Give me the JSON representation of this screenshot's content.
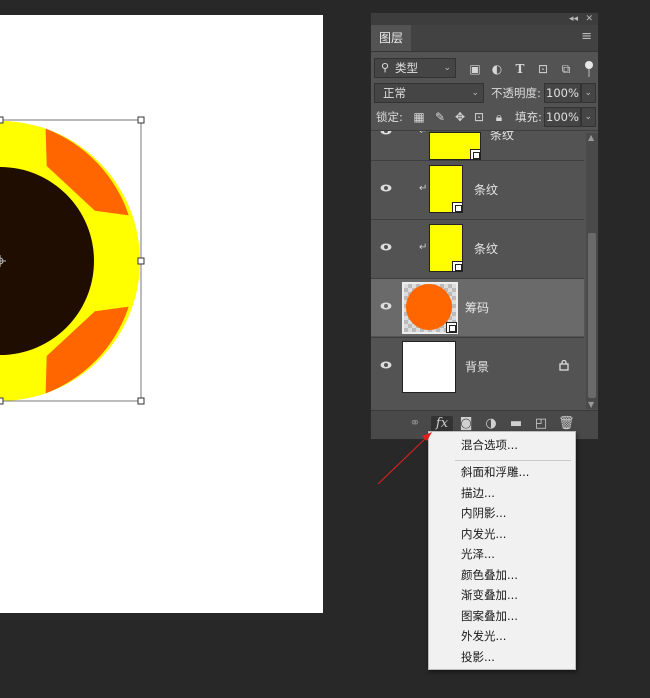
{
  "panel": {
    "tab_label": "图层",
    "menu_icon": "hamburger-icon",
    "collapse_icon": "double-chevron-icon",
    "close_icon": "close-icon"
  },
  "filter": {
    "kind_label": "类型",
    "icons": [
      "image-filter-icon",
      "adjustment-filter-icon",
      "type-filter-icon",
      "shape-filter-icon",
      "smart-object-filter-icon",
      "filter-toggle-icon"
    ]
  },
  "blend": {
    "mode": "正常",
    "opacity_label": "不透明度:",
    "opacity_value": "100%"
  },
  "lock": {
    "label": "锁定:",
    "fill_label": "填充:",
    "fill_value": "100%"
  },
  "layers": [
    {
      "name": "条纹",
      "clipped": true,
      "type": "stripe"
    },
    {
      "name": "条纹",
      "clipped": true,
      "type": "stripe"
    },
    {
      "name": "条纹",
      "clipped": true,
      "type": "stripe"
    },
    {
      "name": "筹码",
      "clipped": false,
      "type": "circle",
      "selected": true
    },
    {
      "name": "背景",
      "clipped": false,
      "type": "background",
      "locked": true
    }
  ],
  "bottom_icons": [
    "link-icon",
    "fx-icon",
    "mask-icon",
    "adjustment-icon",
    "folder-icon",
    "new-layer-icon",
    "trash-icon"
  ],
  "fx_label": "fx",
  "fx_menu": {
    "items": [
      "混合选项...",
      "斜面和浮雕...",
      "描边...",
      "内阴影...",
      "内发光...",
      "光泽...",
      "颜色叠加...",
      "渐变叠加...",
      "图案叠加...",
      "外发光...",
      "投影..."
    ]
  },
  "colors": {
    "orange": "#ff6600",
    "yellow": "#ffff00",
    "dark_brown": "#1e0d00",
    "arrow_red": "#e02020"
  }
}
